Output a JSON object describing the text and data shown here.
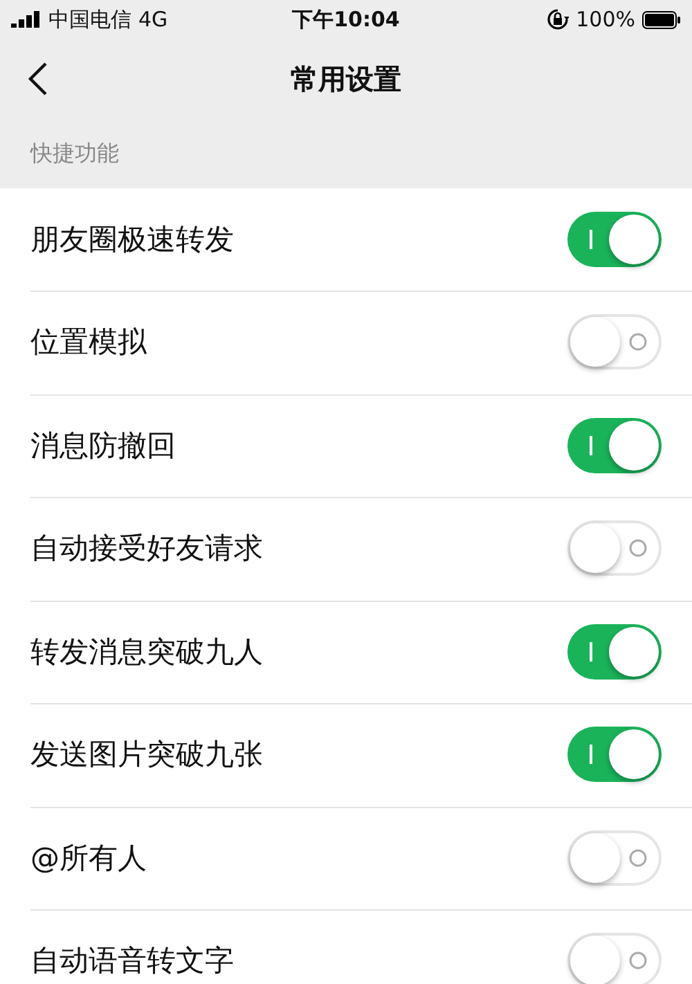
{
  "status_bar": {
    "carrier": "中国电信",
    "network": "4G",
    "time": "下午10:04",
    "battery": "100%"
  },
  "nav": {
    "title": "常用设置"
  },
  "section": {
    "title": "快捷功能"
  },
  "rows": [
    {
      "label": "朋友圈极速转发",
      "on": true
    },
    {
      "label": "位置模拟",
      "on": false
    },
    {
      "label": "消息防撤回",
      "on": true
    },
    {
      "label": "自动接受好友请求",
      "on": false
    },
    {
      "label": "转发消息突破九人",
      "on": true
    },
    {
      "label": "发送图片突破九张",
      "on": true
    },
    {
      "label": "@所有人",
      "on": false
    },
    {
      "label": "自动语音转文字",
      "on": false
    }
  ]
}
